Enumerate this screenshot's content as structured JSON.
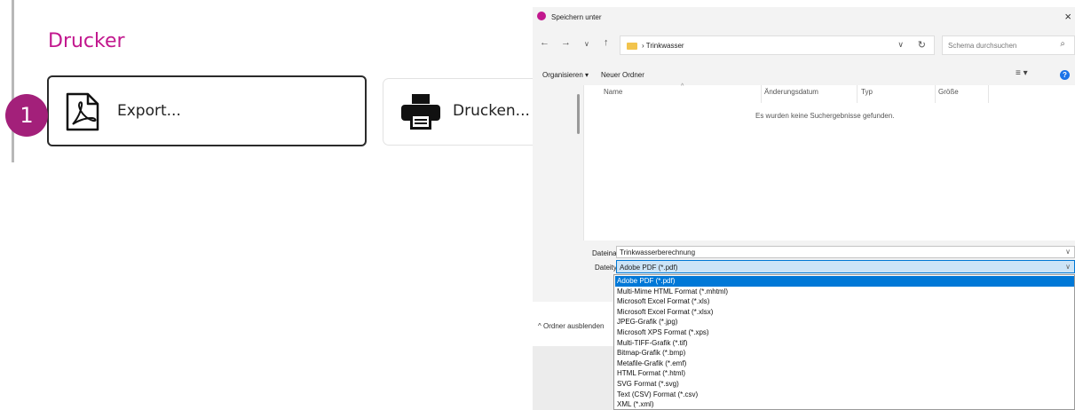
{
  "left_panel": {
    "title": "Drucker",
    "step_number": "1",
    "export_label": "Export...",
    "print_label": "Drucken..."
  },
  "dialog": {
    "title": "Speichern unter",
    "close_glyph": "×",
    "nav": {
      "back": "←",
      "forward": "→",
      "recent": "∨",
      "up": "↑"
    },
    "address_separator": "›",
    "address_path": "Trinkwasser",
    "address_dropdown": "∨",
    "refresh": "↻",
    "search_placeholder": "Schema durchsuchen",
    "search_icon": "⌕",
    "organize": "Organisieren ▾",
    "new_folder": "Neuer Ordner",
    "view_button": "≡ ▾",
    "help": "?",
    "columns": [
      "Name",
      "Änderungsdatum",
      "Typ",
      "Größe"
    ],
    "sort_indicator": "^",
    "empty_message": "Es wurden keine Suchergebnisse gefunden.",
    "filename_label": "Dateiname:",
    "filename_value": "Trinkwasserberechnung",
    "filetype_label": "Dateityp:",
    "filetype_value": "Adobe PDF (*.pdf)",
    "select_arrow": "∨",
    "hide_folders": "^ Ordner ausblenden",
    "filetype_options": [
      "Adobe PDF (*.pdf)",
      "Multi-Mime HTML Format (*.mhtml)",
      "Microsoft Excel Format (*.xls)",
      "Microsoft Excel Format (*.xlsx)",
      "JPEG-Grafik (*.jpg)",
      "Microsoft XPS Format (*.xps)",
      "Multi-TIFF-Grafik (*.tif)",
      "Bitmap-Grafik (*.bmp)",
      "Metafile-Grafik (*.emf)",
      "HTML Format (*.html)",
      "SVG Format (*.svg)",
      "Text (CSV) Format (*.csv)",
      "XML (*.xml)"
    ],
    "selected_option_index": 0
  },
  "colors": {
    "accent_magenta": "#c2188e",
    "badge": "#a3207a",
    "selection_blue": "#0078d7"
  },
  "icons": [
    "pdf-icon",
    "printer-icon",
    "app-icon",
    "folder-icon",
    "search-icon",
    "refresh-icon",
    "help-icon",
    "close-icon"
  ]
}
